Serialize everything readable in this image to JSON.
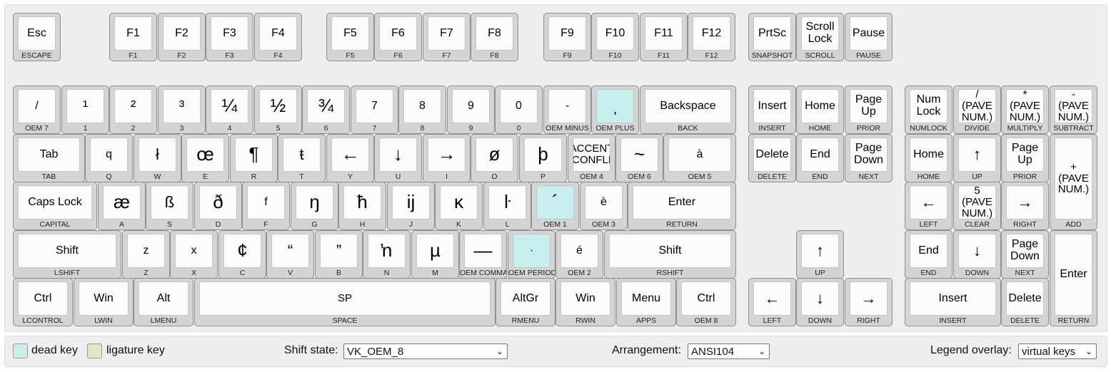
{
  "keys": [
    {
      "cap": "Esc",
      "sub": "ESCAPE",
      "name": "key-escape",
      "s": "sm"
    },
    {
      "cap": "F1",
      "sub": "F1",
      "name": "key-f1",
      "s": "sm"
    },
    {
      "cap": "F2",
      "sub": "F2",
      "name": "key-f2",
      "s": "sm"
    },
    {
      "cap": "F3",
      "sub": "F3",
      "name": "key-f3",
      "s": "sm"
    },
    {
      "cap": "F4",
      "sub": "F4",
      "name": "key-f4",
      "s": "sm"
    },
    {
      "cap": "F5",
      "sub": "F5",
      "name": "key-f5",
      "s": "sm"
    },
    {
      "cap": "F6",
      "sub": "F6",
      "name": "key-f6",
      "s": "sm"
    },
    {
      "cap": "F7",
      "sub": "F7",
      "name": "key-f7",
      "s": "sm"
    },
    {
      "cap": "F8",
      "sub": "F8",
      "name": "key-f8",
      "s": "sm"
    },
    {
      "cap": "F9",
      "sub": "F9",
      "name": "key-f9",
      "s": "sm"
    },
    {
      "cap": "F10",
      "sub": "F10",
      "name": "key-f10",
      "s": "sm"
    },
    {
      "cap": "F11",
      "sub": "F11",
      "name": "key-f11",
      "s": "sm"
    },
    {
      "cap": "F12",
      "sub": "F12",
      "name": "key-f12",
      "s": "sm"
    },
    {
      "cap": "PrtSc",
      "sub": "SNAPSHOT",
      "name": "key-print-screen",
      "s": "sm"
    },
    {
      "cap": "Scroll Lock",
      "sub": "SCROLL",
      "name": "key-scroll-lock",
      "s": "sm"
    },
    {
      "cap": "Pause",
      "sub": "PAUSE",
      "name": "key-pause",
      "s": "sm"
    },
    {
      "cap": "/",
      "sub": "OEM 7",
      "name": "key-oem-7",
      "s": "sm"
    },
    {
      "cap": "¹",
      "sub": "1",
      "name": "key-1",
      "s": "mid"
    },
    {
      "cap": "²",
      "sub": "2",
      "name": "key-2",
      "s": "mid"
    },
    {
      "cap": "³",
      "sub": "3",
      "name": "key-3",
      "s": "mid"
    },
    {
      "cap": "¼",
      "sub": "4",
      "name": "key-4",
      "s": "sym"
    },
    {
      "cap": "½",
      "sub": "5",
      "name": "key-5",
      "s": "sym"
    },
    {
      "cap": "¾",
      "sub": "6",
      "name": "key-6",
      "s": "sym"
    },
    {
      "cap": "7",
      "sub": "7",
      "name": "key-7",
      "s": "sm"
    },
    {
      "cap": "8",
      "sub": "8",
      "name": "key-8",
      "s": "sm"
    },
    {
      "cap": "9",
      "sub": "9",
      "name": "key-9",
      "s": "sm"
    },
    {
      "cap": "0",
      "sub": "0",
      "name": "key-0",
      "s": "sm"
    },
    {
      "cap": "-",
      "sub": "OEM MINUS",
      "name": "key-oem-minus",
      "s": "sm"
    },
    {
      "cap": "̦",
      "sub": "OEM PLUS",
      "name": "key-oem-plus",
      "s": "mid",
      "dead": true
    },
    {
      "cap": "Backspace",
      "sub": "BACK",
      "name": "key-backspace",
      "s": "sm"
    },
    {
      "cap": "Insert",
      "sub": "INSERT",
      "name": "key-insert",
      "s": "sm"
    },
    {
      "cap": "Home",
      "sub": "HOME",
      "name": "key-home",
      "s": "sm"
    },
    {
      "cap": "Page Up",
      "sub": "PRIOR",
      "name": "key-page-up",
      "s": "sm"
    },
    {
      "cap": "Num Lock",
      "sub": "NUMLOCK",
      "name": "key-num-lock",
      "s": "sm"
    },
    {
      "cap": "/ (PAVE NUM.)",
      "sub": "DIVIDE",
      "name": "key-numpad-divide",
      "s": "xs"
    },
    {
      "cap": "* (PAVE NUM.)",
      "sub": "MULTIPLY",
      "name": "key-numpad-multiply",
      "s": "xs"
    },
    {
      "cap": "- (PAVE NUM.)",
      "sub": "SUBTRACT",
      "name": "key-numpad-subtract",
      "s": "xs"
    },
    {
      "cap": "Tab",
      "sub": "TAB",
      "name": "key-tab",
      "s": "sm"
    },
    {
      "cap": "q",
      "sub": "Q",
      "name": "key-q",
      "s": "sm"
    },
    {
      "cap": "ł",
      "sub": "W",
      "name": "key-w",
      "s": "mid"
    },
    {
      "cap": "œ",
      "sub": "E",
      "name": "key-e",
      "s": "sym"
    },
    {
      "cap": "¶",
      "sub": "R",
      "name": "key-r",
      "s": "sym"
    },
    {
      "cap": "ŧ",
      "sub": "T",
      "name": "key-t",
      "s": "mid"
    },
    {
      "cap": "←",
      "sub": "Y",
      "name": "key-y",
      "s": "sym"
    },
    {
      "cap": "↓",
      "sub": "U",
      "name": "key-u",
      "s": "sym"
    },
    {
      "cap": "→",
      "sub": "I",
      "name": "key-i",
      "s": "sym"
    },
    {
      "cap": "ø",
      "sub": "O",
      "name": "key-o",
      "s": "sym"
    },
    {
      "cap": "þ",
      "sub": "P",
      "name": "key-p",
      "s": "sym"
    },
    {
      "cap": "ACCENT CIRCONFLEXE",
      "sub": "OEM 4",
      "name": "key-oem-4",
      "s": "xs"
    },
    {
      "cap": "~",
      "sub": "OEM 6",
      "name": "key-oem-6",
      "s": "sym"
    },
    {
      "cap": "à",
      "sub": "OEM 5",
      "name": "key-oem-5",
      "s": "sm"
    },
    {
      "cap": "Delete",
      "sub": "DELETE",
      "name": "key-delete",
      "s": "sm"
    },
    {
      "cap": "End",
      "sub": "END",
      "name": "key-end",
      "s": "sm"
    },
    {
      "cap": "Page Down",
      "sub": "NEXT",
      "name": "key-page-down",
      "s": "sm"
    },
    {
      "cap": "Home",
      "sub": "HOME",
      "name": "key-numpad-7",
      "s": "sm"
    },
    {
      "cap": "↑",
      "sub": "UP",
      "name": "key-numpad-8",
      "s": "mid"
    },
    {
      "cap": "Page Up",
      "sub": "PRIOR",
      "name": "key-numpad-9",
      "s": "sm"
    },
    {
      "cap": "+ (PAVE NUM.)",
      "sub": "ADD",
      "name": "key-numpad-add",
      "s": "xs"
    },
    {
      "cap": "Caps Lock",
      "sub": "CAPITAL",
      "name": "key-caps-lock",
      "s": "sm"
    },
    {
      "cap": "æ",
      "sub": "A",
      "name": "key-a",
      "s": "sym"
    },
    {
      "cap": "ß",
      "sub": "S",
      "name": "key-s",
      "s": "mid"
    },
    {
      "cap": "ð",
      "sub": "D",
      "name": "key-d",
      "s": "sym"
    },
    {
      "cap": "f",
      "sub": "F",
      "name": "key-f",
      "s": "sm"
    },
    {
      "cap": "ŋ",
      "sub": "G",
      "name": "key-g",
      "s": "sym"
    },
    {
      "cap": "ħ",
      "sub": "H",
      "name": "key-h",
      "s": "sym"
    },
    {
      "cap": "ĳ",
      "sub": "J",
      "name": "key-j",
      "s": "sym"
    },
    {
      "cap": "ĸ",
      "sub": "K",
      "name": "key-k",
      "s": "sym"
    },
    {
      "cap": "ŀ",
      "sub": "L",
      "name": "key-l",
      "s": "sym"
    },
    {
      "cap": "´",
      "sub": "OEM 1",
      "name": "key-oem-1",
      "s": "sym",
      "dead": true
    },
    {
      "cap": "è",
      "sub": "OEM 3",
      "name": "key-oem-3",
      "s": "sm"
    },
    {
      "cap": "Enter",
      "sub": "RETURN",
      "name": "key-enter",
      "s": "sm"
    },
    {
      "cap": "←",
      "sub": "LEFT",
      "name": "key-numpad-4",
      "s": "mid"
    },
    {
      "cap": "5 (PAVE NUM.)",
      "sub": "CLEAR",
      "name": "key-numpad-5",
      "s": "xs"
    },
    {
      "cap": "→",
      "sub": "RIGHT",
      "name": "key-numpad-6",
      "s": "mid"
    },
    {
      "cap": "Shift",
      "sub": "LSHIFT",
      "name": "key-left-shift",
      "s": "sm"
    },
    {
      "cap": "z",
      "sub": "Z",
      "name": "key-z",
      "s": "sm"
    },
    {
      "cap": "x",
      "sub": "X",
      "name": "key-x",
      "s": "sm"
    },
    {
      "cap": "¢",
      "sub": "C",
      "name": "key-c",
      "s": "sym"
    },
    {
      "cap": "“",
      "sub": "V",
      "name": "key-v",
      "s": "mid"
    },
    {
      "cap": "”",
      "sub": "B",
      "name": "key-b",
      "s": "mid"
    },
    {
      "cap": "ŉ",
      "sub": "N",
      "name": "key-n",
      "s": "sym"
    },
    {
      "cap": "µ",
      "sub": "M",
      "name": "key-m",
      "s": "sym"
    },
    {
      "cap": "—",
      "sub": "OEM COMMA",
      "name": "key-oem-comma",
      "s": "sym"
    },
    {
      "cap": "·",
      "sub": "OEM PERIOD",
      "name": "key-oem-period",
      "s": "sm",
      "dead": true
    },
    {
      "cap": "é",
      "sub": "OEM 2",
      "name": "key-oem-2",
      "s": "sm"
    },
    {
      "cap": "Shift",
      "sub": "RSHIFT",
      "name": "key-right-shift",
      "s": "sm"
    },
    {
      "cap": "↑",
      "sub": "UP",
      "name": "key-arrow-up",
      "s": "mid"
    },
    {
      "cap": "End",
      "sub": "END",
      "name": "key-numpad-1",
      "s": "sm"
    },
    {
      "cap": "↓",
      "sub": "DOWN",
      "name": "key-numpad-2",
      "s": "mid"
    },
    {
      "cap": "Page Down",
      "sub": "NEXT",
      "name": "key-numpad-3",
      "s": "sm"
    },
    {
      "cap": "Enter",
      "sub": "RETURN",
      "name": "key-numpad-enter",
      "s": "sm"
    },
    {
      "cap": "Ctrl",
      "sub": "LCONTROL",
      "name": "key-left-ctrl",
      "s": "sm"
    },
    {
      "cap": "Win",
      "sub": "LWIN",
      "name": "key-left-win",
      "s": "sm"
    },
    {
      "cap": "Alt",
      "sub": "LMENU",
      "name": "key-left-alt",
      "s": "sm"
    },
    {
      "cap": "SP",
      "sub": "SPACE",
      "name": "key-space",
      "s": "xs"
    },
    {
      "cap": "AltGr",
      "sub": "RMENU",
      "name": "key-altgr",
      "s": "sm"
    },
    {
      "cap": "Win",
      "sub": "RWIN",
      "name": "key-right-win",
      "s": "sm"
    },
    {
      "cap": "Menu",
      "sub": "APPS",
      "name": "key-menu",
      "s": "sm"
    },
    {
      "cap": "Ctrl",
      "sub": "OEM 8",
      "name": "key-right-ctrl",
      "s": "sm"
    },
    {
      "cap": "←",
      "sub": "LEFT",
      "name": "key-arrow-left",
      "s": "mid"
    },
    {
      "cap": "↓",
      "sub": "DOWN",
      "name": "key-arrow-down",
      "s": "mid"
    },
    {
      "cap": "→",
      "sub": "RIGHT",
      "name": "key-arrow-right",
      "s": "mid"
    },
    {
      "cap": "Insert",
      "sub": "INSERT",
      "name": "key-numpad-0",
      "s": "sm"
    },
    {
      "cap": "Delete",
      "sub": "DELETE",
      "name": "key-numpad-decimal",
      "s": "sm"
    }
  ],
  "legend": {
    "dead_key_label": "dead key",
    "dead_key_color": "#c8eded",
    "ligature_key_label": "ligature key",
    "ligature_key_color": "#e8e4bf"
  },
  "controls": {
    "shift_state_label": "Shift state:",
    "shift_state_value": "VK_OEM_8",
    "arrangement_label": "Arrangement:",
    "arrangement_value": "ANSI104",
    "legend_overlay_label": "Legend overlay:",
    "legend_overlay_value": "virtual keys"
  }
}
